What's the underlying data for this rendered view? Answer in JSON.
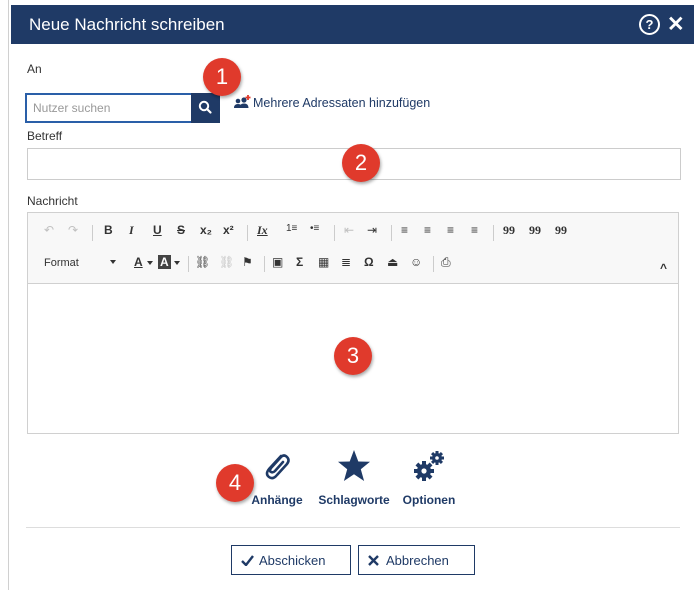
{
  "dialog": {
    "title": "Neue Nachricht schreiben",
    "help_glyph": "?",
    "close_glyph": "✕"
  },
  "recipients": {
    "label": "An",
    "search_placeholder": "Nutzer suchen",
    "multi_link": "Mehrere Adressaten hinzufügen"
  },
  "subject": {
    "label": "Betreff",
    "value": ""
  },
  "message": {
    "label": "Nachricht",
    "format_label": "Format",
    "toolbar_row1": [
      "↶",
      "↷",
      "B",
      "I",
      "U",
      "S",
      "x₂",
      "x²",
      "Ix",
      "1≡",
      "•≡",
      "⇤",
      "⇥",
      "≡",
      "≡",
      "≡",
      "≡",
      "99",
      "99",
      "99"
    ],
    "toolbar_row2": [
      "A",
      "A",
      "⛓",
      "⛓",
      "⚑",
      "▣",
      "Σ",
      "▦",
      "≣",
      "Ω",
      "⏏",
      "☺",
      "⎙",
      "^"
    ]
  },
  "badges": [
    "1",
    "2",
    "3",
    "4"
  ],
  "actions": [
    {
      "label": "Anhänge",
      "icon": "paperclip-icon"
    },
    {
      "label": "Schlagworte",
      "icon": "star-icon"
    },
    {
      "label": "Optionen",
      "icon": "gears-icon"
    }
  ],
  "buttons": {
    "send": "Abschicken",
    "cancel": "Abbrechen"
  },
  "colors": {
    "primary": "#1f3a66",
    "badge": "#e03a2c"
  }
}
